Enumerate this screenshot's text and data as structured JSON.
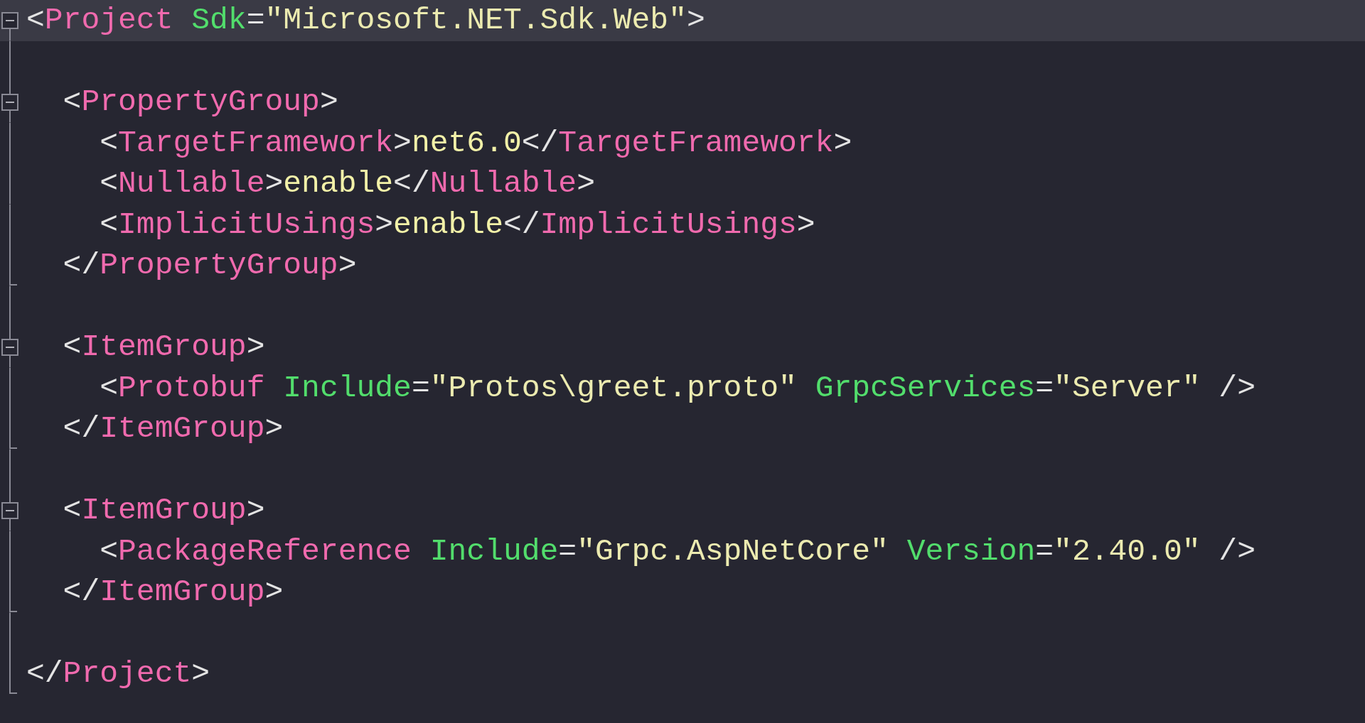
{
  "editor": {
    "lines": [
      {
        "kind": "fold-start",
        "current": true,
        "tokens": [
          {
            "kind": "punct",
            "text": "<"
          },
          {
            "kind": "tag",
            "text": "Project "
          },
          {
            "kind": "attr",
            "text": "Sdk"
          },
          {
            "kind": "punct",
            "text": "="
          },
          {
            "kind": "string",
            "text": "\"Microsoft.NET.Sdk.Web\""
          },
          {
            "kind": "punct",
            "text": ">"
          }
        ]
      },
      {
        "kind": "body",
        "current": false
      },
      {
        "kind": "fold-start",
        "current": false,
        "tokens": [
          {
            "kind": "punct",
            "text": "  <"
          },
          {
            "kind": "tag",
            "text": "PropertyGroup"
          },
          {
            "kind": "punct",
            "text": ">"
          }
        ]
      },
      {
        "kind": "body",
        "current": false,
        "tokens": [
          {
            "kind": "punct",
            "text": "    <"
          },
          {
            "kind": "tag",
            "text": "TargetFramework"
          },
          {
            "kind": "punct",
            "text": ">"
          },
          {
            "kind": "text",
            "text": "net6.0"
          },
          {
            "kind": "punct",
            "text": "</"
          },
          {
            "kind": "tag",
            "text": "TargetFramework"
          },
          {
            "kind": "punct",
            "text": ">"
          }
        ]
      },
      {
        "kind": "body",
        "current": false,
        "tokens": [
          {
            "kind": "punct",
            "text": "    <"
          },
          {
            "kind": "tag",
            "text": "Nullable"
          },
          {
            "kind": "punct",
            "text": ">"
          },
          {
            "kind": "text",
            "text": "enable"
          },
          {
            "kind": "punct",
            "text": "</"
          },
          {
            "kind": "tag",
            "text": "Nullable"
          },
          {
            "kind": "punct",
            "text": ">"
          }
        ]
      },
      {
        "kind": "body",
        "current": false,
        "tokens": [
          {
            "kind": "punct",
            "text": "    <"
          },
          {
            "kind": "tag",
            "text": "ImplicitUsings"
          },
          {
            "kind": "punct",
            "text": ">"
          },
          {
            "kind": "text",
            "text": "enable"
          },
          {
            "kind": "punct",
            "text": "</"
          },
          {
            "kind": "tag",
            "text": "ImplicitUsings"
          },
          {
            "kind": "punct",
            "text": ">"
          }
        ]
      },
      {
        "kind": "fold-end",
        "current": false,
        "tokens": [
          {
            "kind": "punct",
            "text": "  </"
          },
          {
            "kind": "tag",
            "text": "PropertyGroup"
          },
          {
            "kind": "punct",
            "text": ">"
          }
        ]
      },
      {
        "kind": "body",
        "current": false
      },
      {
        "kind": "fold-start",
        "current": false,
        "tokens": [
          {
            "kind": "punct",
            "text": "  <"
          },
          {
            "kind": "tag",
            "text": "ItemGroup"
          },
          {
            "kind": "punct",
            "text": ">"
          }
        ]
      },
      {
        "kind": "body",
        "current": false,
        "tokens": [
          {
            "kind": "punct",
            "text": "    <"
          },
          {
            "kind": "tag",
            "text": "Protobuf "
          },
          {
            "kind": "attr",
            "text": "Include"
          },
          {
            "kind": "punct",
            "text": "="
          },
          {
            "kind": "string",
            "text": "\"Protos\\greet.proto\" "
          },
          {
            "kind": "attr",
            "text": "GrpcServices"
          },
          {
            "kind": "punct",
            "text": "="
          },
          {
            "kind": "string",
            "text": "\"Server\""
          },
          {
            "kind": "punct",
            "text": " />"
          }
        ]
      },
      {
        "kind": "fold-end",
        "current": false,
        "tokens": [
          {
            "kind": "punct",
            "text": "  </"
          },
          {
            "kind": "tag",
            "text": "ItemGroup"
          },
          {
            "kind": "punct",
            "text": ">"
          }
        ]
      },
      {
        "kind": "body",
        "current": false
      },
      {
        "kind": "fold-start",
        "current": false,
        "tokens": [
          {
            "kind": "punct",
            "text": "  <"
          },
          {
            "kind": "tag",
            "text": "ItemGroup"
          },
          {
            "kind": "punct",
            "text": ">"
          }
        ]
      },
      {
        "kind": "body",
        "current": false,
        "tokens": [
          {
            "kind": "punct",
            "text": "    <"
          },
          {
            "kind": "tag",
            "text": "PackageReference "
          },
          {
            "kind": "attr",
            "text": "Include"
          },
          {
            "kind": "punct",
            "text": "="
          },
          {
            "kind": "string",
            "text": "\"Grpc.AspNetCore\" "
          },
          {
            "kind": "attr",
            "text": "Version"
          },
          {
            "kind": "punct",
            "text": "="
          },
          {
            "kind": "string",
            "text": "\"2.40.0\""
          },
          {
            "kind": "punct",
            "text": " />"
          }
        ]
      },
      {
        "kind": "fold-end",
        "current": false,
        "tokens": [
          {
            "kind": "punct",
            "text": "  </"
          },
          {
            "kind": "tag",
            "text": "ItemGroup"
          },
          {
            "kind": "punct",
            "text": ">"
          }
        ]
      },
      {
        "kind": "body",
        "current": false
      },
      {
        "kind": "fold-end",
        "current": false,
        "tokens": [
          {
            "kind": "punct",
            "text": "</"
          },
          {
            "kind": "tag",
            "text": "Project"
          },
          {
            "kind": "punct",
            "text": ">"
          }
        ]
      }
    ]
  }
}
